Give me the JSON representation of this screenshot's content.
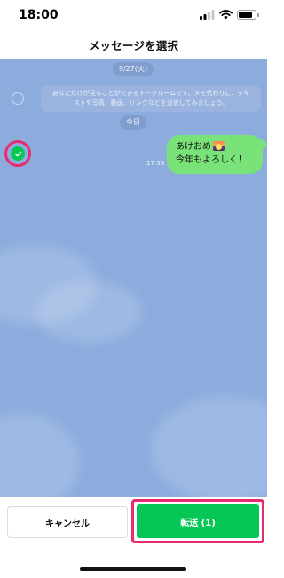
{
  "status_bar": {
    "time": "18:00",
    "battery_level": 0.85
  },
  "header": {
    "title": "メッセージを選択"
  },
  "chat": {
    "date_chip_1": "9/27(火)",
    "system_message_line1": "あなただけが見ることができるトークルームです。メモ代わりに、テキ",
    "system_message_line2": "ストや写真、動画、リンクなどを送信してみましょう。",
    "date_chip_2": "今日",
    "message": {
      "time": "17:59",
      "line1": "あけおめ",
      "line2": "今年もよろしく！",
      "emoji_icon": "sunrise-icon",
      "selected": true
    }
  },
  "bottom_bar": {
    "cancel_label": "キャンセル",
    "forward_label": "転送 (1)"
  },
  "colors": {
    "accent": "#06C755",
    "highlight": "#EA2A6E",
    "chat_background": "#8CACDE",
    "bubble": "#79E278"
  }
}
